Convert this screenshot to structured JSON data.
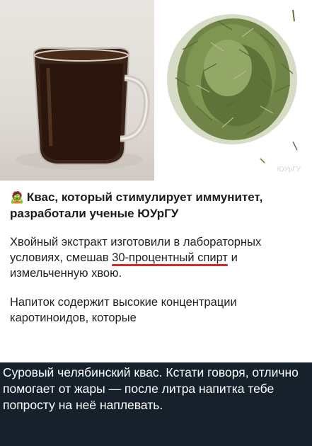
{
  "image": {
    "watermark": "ЮУрГУ",
    "headline_emoji": "🧟",
    "headline": "Квас, который стимулирует иммунитет, разработали ученые ЮУрГУ",
    "p1_before": "Хвойный экстракт изготовили в лабораторных условиях, смешав",
    "p1_underlined": "30-процентный спирт",
    "p1_after": "и измельченную хвою.",
    "p2": "Напиток содержит высокие концентрации каротиноидов, которые"
  },
  "caption": "Суровый челябинский квас. Кстати говоря, отлично помогает от жары — после литра напитка тебе попросту на неё наплевать.",
  "colors": {
    "background": "#17212b",
    "underline": "#d8262c"
  }
}
